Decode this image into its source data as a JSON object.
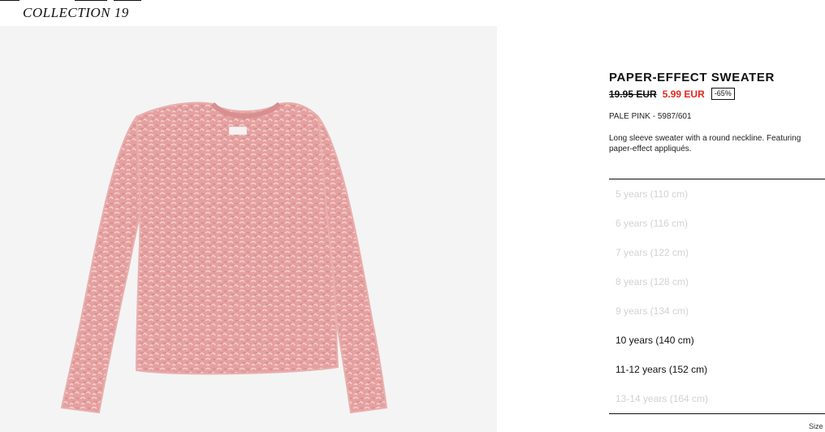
{
  "header": {
    "collection_label": "COLLECTION 19"
  },
  "product": {
    "image_alt": "sweater-image",
    "title": "PAPER-EFFECT SWEATER",
    "old_price": "19.95 EUR",
    "new_price": "5.99 EUR",
    "discount": "-65%",
    "color_ref": "PALE PINK - 5987/601",
    "description": "Long sleeve sweater with a round neckline. Featuring paper-effect appliqués.",
    "sizes": [
      {
        "label": "5 years (110 cm)",
        "available": false
      },
      {
        "label": "6 years (116 cm)",
        "available": false
      },
      {
        "label": "7 years (122 cm)",
        "available": false
      },
      {
        "label": "8 years (128 cm)",
        "available": false
      },
      {
        "label": "9 years (134 cm)",
        "available": false
      },
      {
        "label": "10 years (140 cm)",
        "available": true
      },
      {
        "label": "11-12 years (152 cm)",
        "available": true
      },
      {
        "label": "13-14 years (164 cm)",
        "available": false
      }
    ],
    "size_guide_label": "Size"
  },
  "colors": {
    "sale": "#e5271d",
    "sweater": "#e8a5a5",
    "image_background": "#f4f4f4"
  }
}
